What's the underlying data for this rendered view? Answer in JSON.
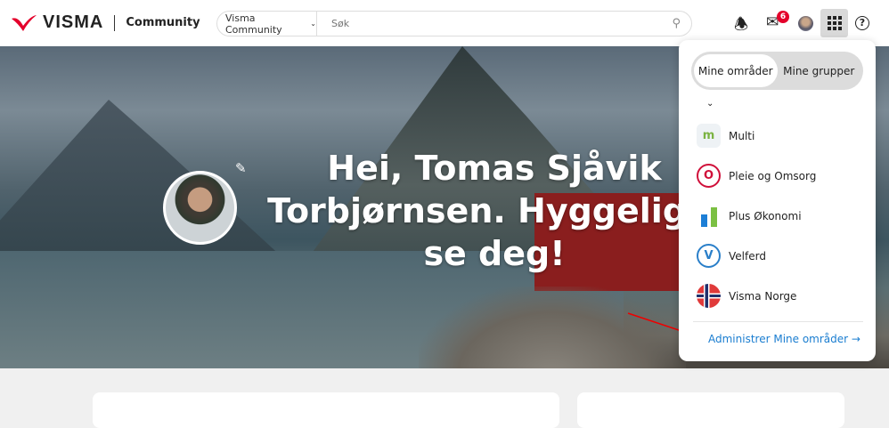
{
  "header": {
    "logo_text": "VISMA",
    "community_label": "Community",
    "search_scope": "Visma Community",
    "search_placeholder": "Søk",
    "notification_count": "6"
  },
  "hero": {
    "greeting": "Hei, Tomas Sjåvik Torbjørnsen. Hyggelig å se deg!"
  },
  "dropdown": {
    "tabs": [
      {
        "label": "Mine områder",
        "active": true
      },
      {
        "label": "Mine grupper",
        "active": false
      }
    ],
    "items": [
      {
        "label": "Multi",
        "icon": "multi-logo"
      },
      {
        "label": "Pleie og Omsorg",
        "icon": "pleie-logo"
      },
      {
        "label": "Plus Økonomi",
        "icon": "plus-okonomi-logo"
      },
      {
        "label": "Velferd",
        "icon": "velferd-logo"
      },
      {
        "label": "Visma Norge",
        "icon": "norway-flag"
      }
    ],
    "manage_link": "Administrer Mine områder →"
  },
  "colors": {
    "brand_red": "#e4002b",
    "link": "#1a7dd0"
  }
}
